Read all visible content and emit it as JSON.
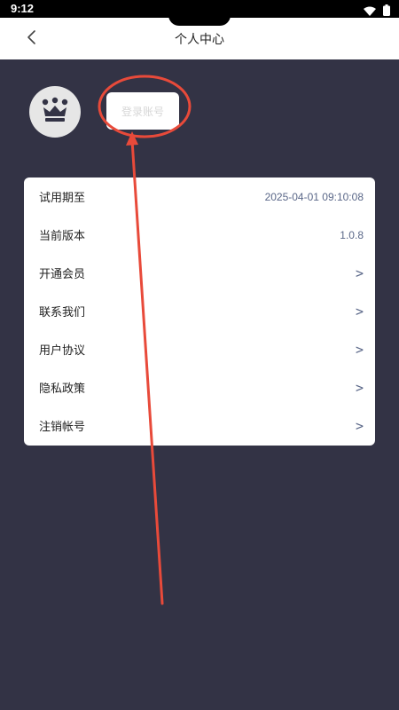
{
  "status_bar": {
    "time": "9:12",
    "icons": [
      "wifi-icon",
      "battery-icon"
    ]
  },
  "header": {
    "title": "个人中心",
    "back_icon": "chevron-left-icon"
  },
  "profile": {
    "avatar_icon": "crown-icon",
    "login_label": "登录账号"
  },
  "rows": [
    {
      "label": "试用期至",
      "value": "2025-04-01 09:10:08"
    },
    {
      "label": "当前版本",
      "value": "1.0.8"
    },
    {
      "label": "开通会员",
      "value": ">"
    },
    {
      "label": "联系我们",
      "value": ">"
    },
    {
      "label": "用户协议",
      "value": ">"
    },
    {
      "label": "隐私政策",
      "value": ">"
    },
    {
      "label": "注销帐号",
      "value": ">"
    }
  ],
  "colors": {
    "background": "#333345",
    "annotation": "#e84a3a",
    "value_text": "#5a6788"
  }
}
